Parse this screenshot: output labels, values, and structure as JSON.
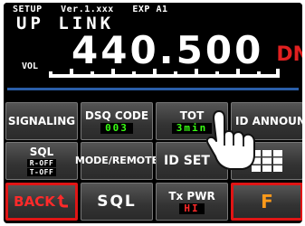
{
  "header": {
    "setup": "SETUP",
    "version": "Ver.1.xxx",
    "exp": "EXP A1",
    "mode_title": "UP LINK",
    "frequency": "440.500",
    "mode_indicator": "DN",
    "volume_label": "VOL"
  },
  "buttons": {
    "signaling": "SIGNALING",
    "dsq_code": "DSQ CODE",
    "dsq_code_value": "003",
    "tot": "TOT",
    "tot_value": "3min",
    "id_announce": "ID ANNOUNCE",
    "sql": "SQL",
    "sql_value_1": "R-OFF",
    "sql_value_2": "T-OFF",
    "mode_remote": "MODE/REMOTE",
    "id_set": "ID SET",
    "back": "BACK",
    "sql_bottom": "SQL",
    "tx_pwr": "Tx PWR",
    "tx_pwr_value": "HI",
    "f": "F"
  },
  "colors": {
    "accent_green": "#39ff14",
    "accent_red": "#e01515",
    "f_orange": "#ff9a1a",
    "separator_blue": "#2a5ea8"
  }
}
